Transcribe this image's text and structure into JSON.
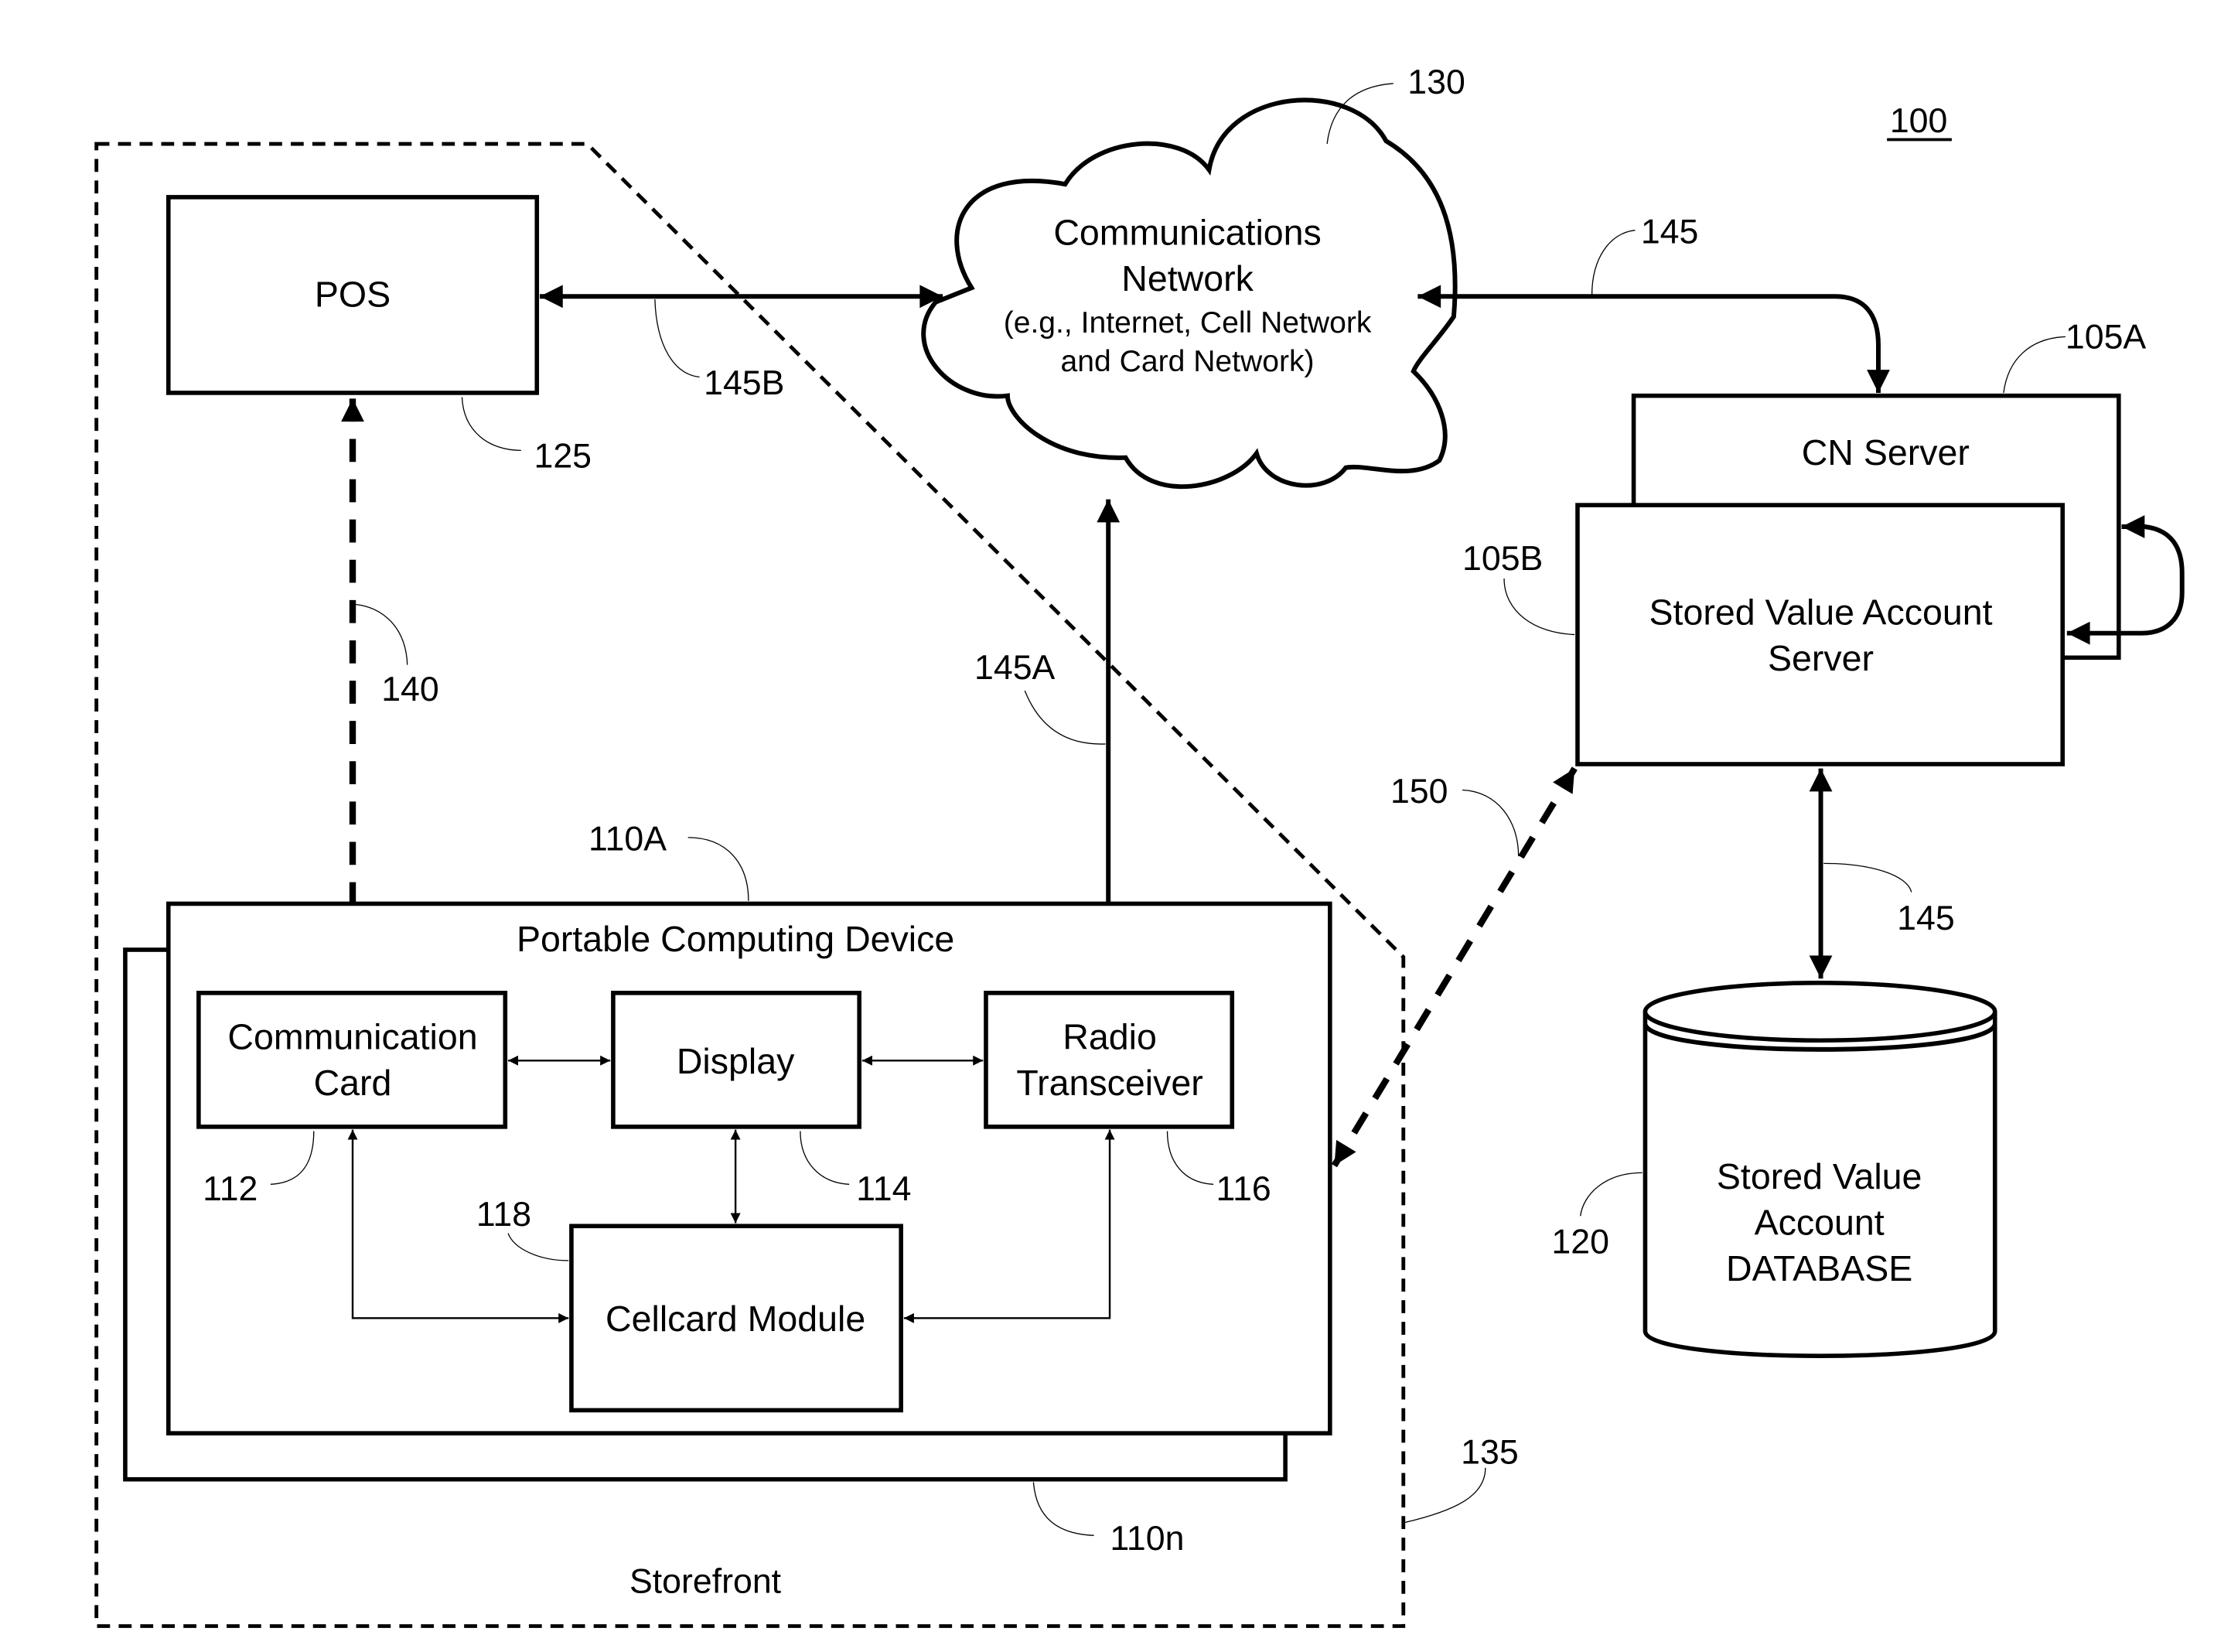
{
  "figure": {
    "figure_ref": "100",
    "storefront": {
      "label": "Storefront",
      "ref": "135"
    },
    "network": {
      "title_line1": "Communications",
      "title_line2": "Network",
      "sub_line1": "(e.g., Internet, Cell Network",
      "sub_line2": "and Card Network)",
      "ref": "130"
    },
    "pos": {
      "label": "POS",
      "ref": "125"
    },
    "cn_server": {
      "label": "CN Server",
      "ref": "105A"
    },
    "sva_server": {
      "label_line1": "Stored Value Account",
      "label_line2": "Server",
      "ref": "105B"
    },
    "database": {
      "label_line1": "Stored Value",
      "label_line2": "Account",
      "label_line3": "DATABASE",
      "ref": "120"
    },
    "pcd": {
      "title": "Portable Computing Device",
      "ref_front": "110A",
      "ref_back": "110n",
      "comm_card": {
        "label_line1": "Communication",
        "label_line2": "Card",
        "ref": "112"
      },
      "display": {
        "label": "Display",
        "ref": "114"
      },
      "radio": {
        "label_line1": "Radio",
        "label_line2": "Transceiver",
        "ref": "116"
      },
      "cellcard": {
        "label": "Cellcard Module",
        "ref": "118"
      }
    },
    "links": {
      "pos_network": "145B",
      "network_radio": "145A",
      "network_cn": "145",
      "sva_db": "145",
      "pos_comm": "140",
      "sva_pcd": "150"
    }
  }
}
